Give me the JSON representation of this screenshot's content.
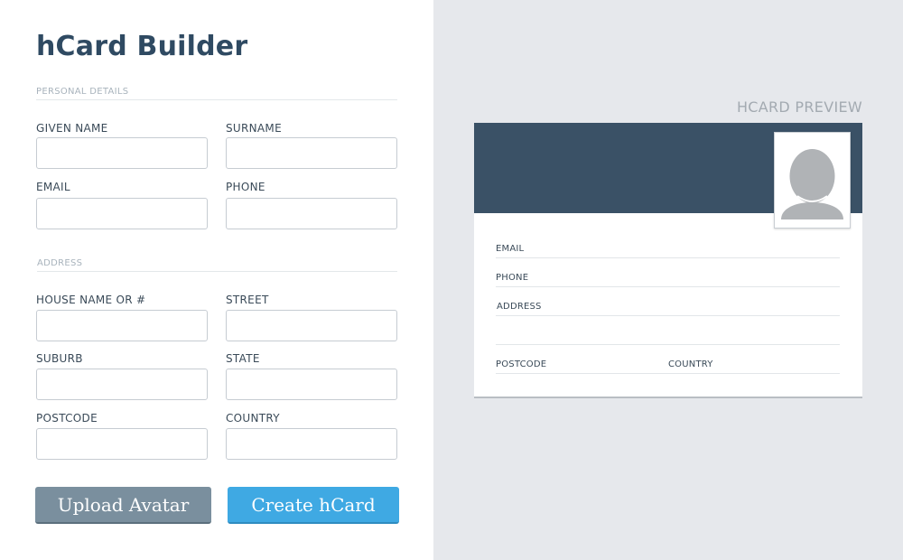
{
  "app": {
    "title": "hCard Builder"
  },
  "form": {
    "sections": {
      "personal": "PERSONAL DETAILS",
      "address": "ADDRESS"
    },
    "fields": {
      "given_name": {
        "label": "GIVEN NAME",
        "value": ""
      },
      "surname": {
        "label": "SURNAME",
        "value": ""
      },
      "email": {
        "label": "EMAIL",
        "value": ""
      },
      "phone": {
        "label": "PHONE",
        "value": ""
      },
      "house": {
        "label": "HOUSE NAME OR #",
        "value": ""
      },
      "street": {
        "label": "STREET",
        "value": ""
      },
      "suburb": {
        "label": "SUBURB",
        "value": ""
      },
      "state": {
        "label": "STATE",
        "value": ""
      },
      "postcode": {
        "label": "POSTCODE",
        "value": ""
      },
      "country": {
        "label": "COUNTRY",
        "value": ""
      }
    },
    "buttons": {
      "upload": "Upload Avatar",
      "create": "Create hCard"
    }
  },
  "preview": {
    "label": "HCARD PREVIEW",
    "name": "",
    "rows": {
      "email": {
        "label": "EMAIL",
        "value": ""
      },
      "phone": {
        "label": "PHONE",
        "value": ""
      },
      "address": {
        "label": "ADDRESS",
        "value": ""
      },
      "address_line2": {
        "value": ""
      },
      "postcode": {
        "label": "POSTCODE",
        "value": ""
      },
      "country": {
        "label": "COUNTRY",
        "value": ""
      }
    },
    "avatar_icon": "user-silhouette-icon"
  },
  "colors": {
    "header": "#3a5166",
    "accent": "#3fa9e3",
    "secondary_button": "#7a8f9e",
    "title": "#2f4a62",
    "preview_bg": "#e6e8ec"
  }
}
